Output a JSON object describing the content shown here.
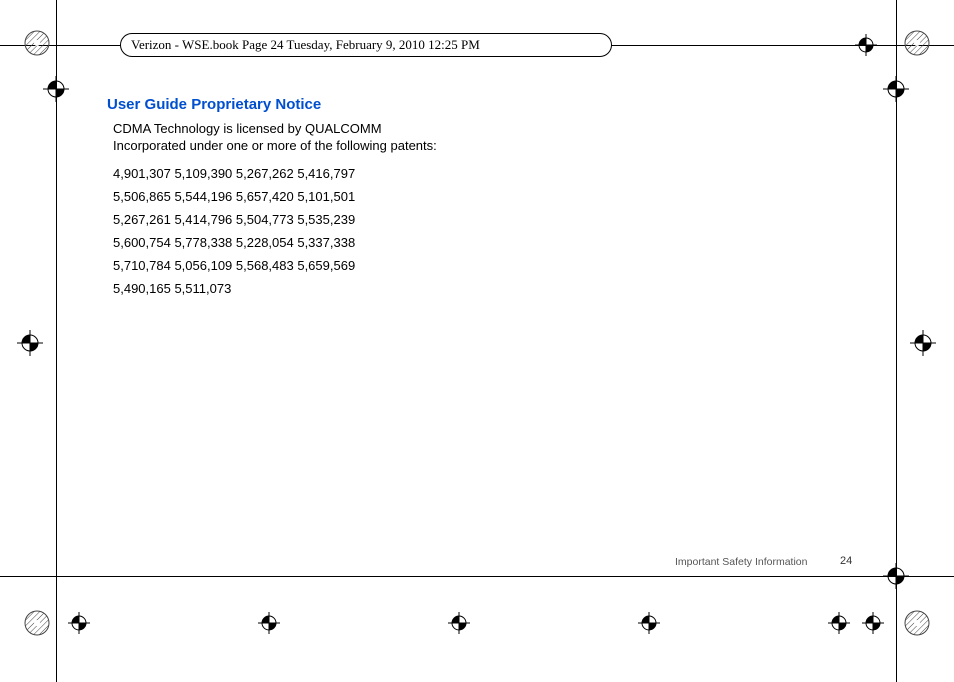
{
  "header": {
    "text": "Verizon - WSE.book  Page 24  Tuesday, February 9, 2010  12:25 PM"
  },
  "section": {
    "heading": "User Guide Proprietary Notice",
    "intro": "CDMA Technology is licensed by QUALCOMM Incorporated under one or more of the following patents:",
    "patents": [
      "4,901,307 5,109,390 5,267,262 5,416,797",
      "5,506,865 5,544,196 5,657,420 5,101,501",
      "5,267,261 5,414,796 5,504,773 5,535,239",
      "5,600,754 5,778,338 5,228,054 5,337,338",
      "5,710,784 5,056,109 5,568,483 5,659,569",
      "5,490,165 5,511,073"
    ]
  },
  "footer": {
    "section_label": "Important Safety Information",
    "page_number": "24"
  }
}
